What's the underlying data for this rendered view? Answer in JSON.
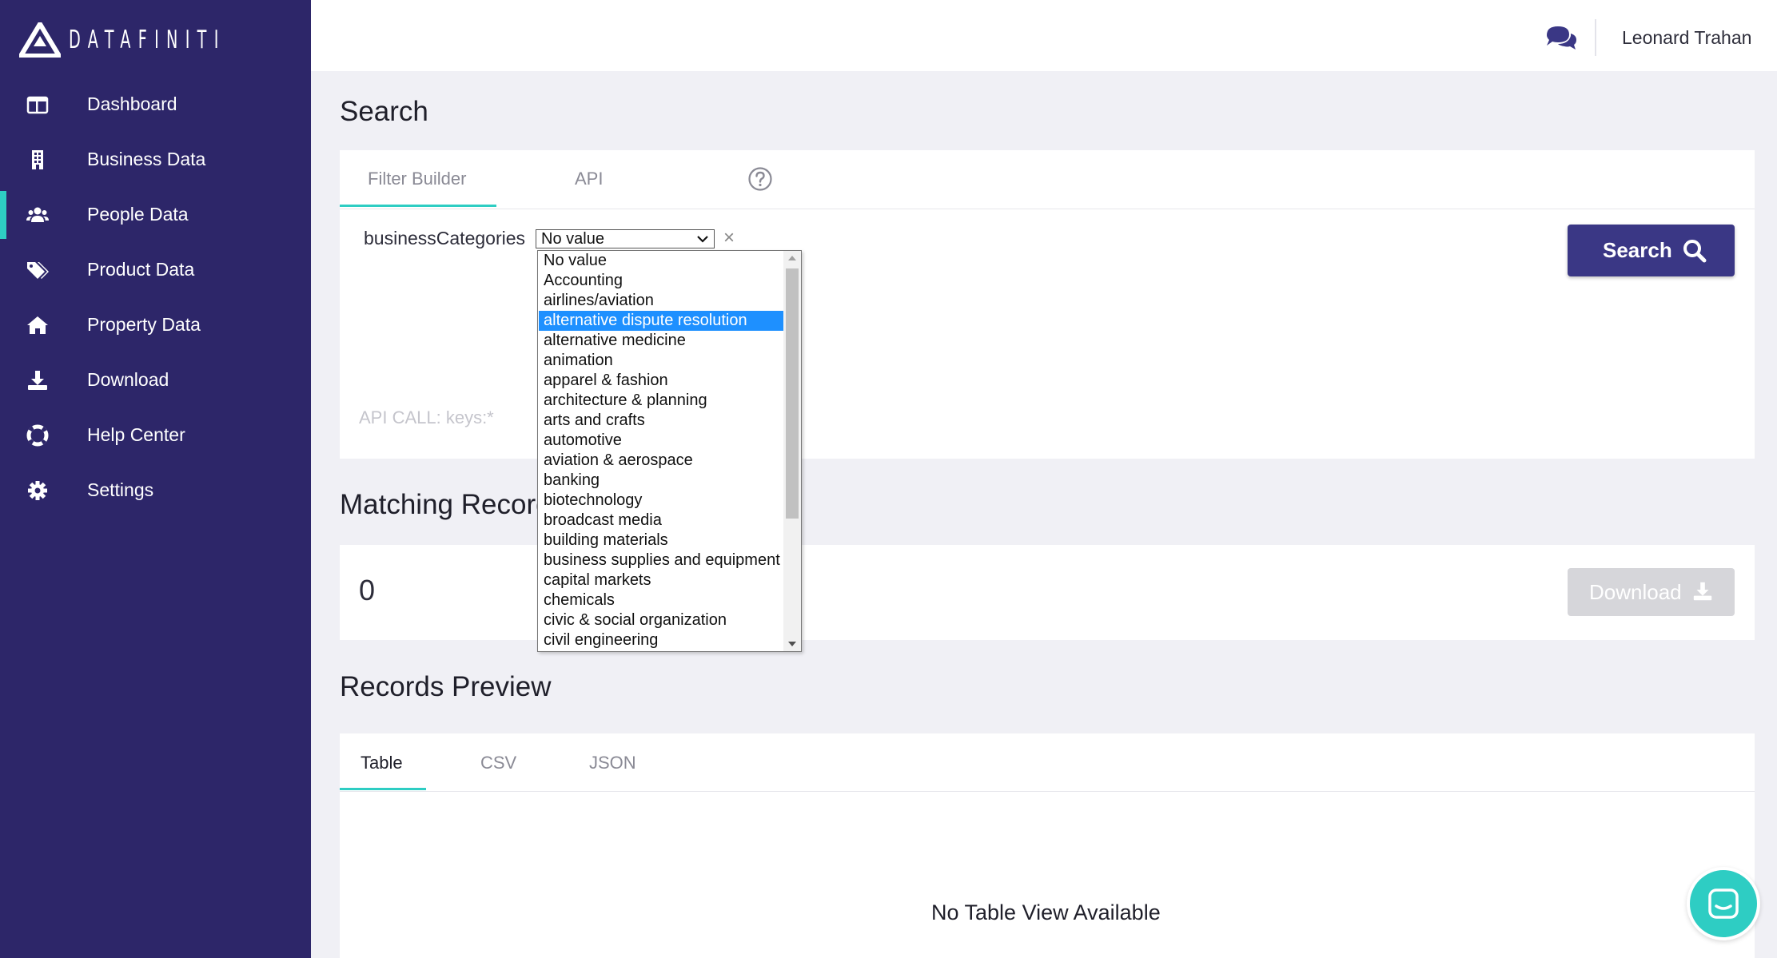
{
  "brand": {
    "name": "DATAFINITI"
  },
  "sidebar": {
    "items": [
      {
        "label": "Dashboard",
        "icon": "dashboard-icon"
      },
      {
        "label": "Business Data",
        "icon": "building-icon"
      },
      {
        "label": "People Data",
        "icon": "users-icon",
        "active": true
      },
      {
        "label": "Product Data",
        "icon": "tags-icon"
      },
      {
        "label": "Property Data",
        "icon": "home-icon"
      },
      {
        "label": "Download",
        "icon": "download-icon"
      },
      {
        "label": "Help Center",
        "icon": "life-ring-icon"
      },
      {
        "label": "Settings",
        "icon": "gear-icon"
      }
    ]
  },
  "header": {
    "user_name": "Leonard Trahan",
    "chat_icon": "comments-icon"
  },
  "search": {
    "title": "Search",
    "tabs": [
      {
        "label": "Filter Builder",
        "active": true
      },
      {
        "label": "API"
      }
    ],
    "help_icon": "question-circle-icon",
    "filter": {
      "field": "businessCategories",
      "selected": "No value",
      "options": [
        "No value",
        "Accounting",
        "airlines/aviation",
        "alternative dispute resolution",
        "alternative medicine",
        "animation",
        "apparel & fashion",
        "architecture & planning",
        "arts and crafts",
        "automotive",
        "aviation & aerospace",
        "banking",
        "biotechnology",
        "broadcast media",
        "building materials",
        "business supplies and equipment",
        "capital markets",
        "chemicals",
        "civic & social organization",
        "civil engineering"
      ],
      "highlighted": "alternative dispute resolution",
      "clear_label": "×"
    },
    "api_call": "API CALL: keys:*",
    "button_label": "Search"
  },
  "matching": {
    "title": "Matching Records",
    "count": "0",
    "download_label": "Download"
  },
  "preview": {
    "title": "Records Preview",
    "tabs": [
      {
        "label": "Table",
        "active": true
      },
      {
        "label": "CSV"
      },
      {
        "label": "JSON"
      }
    ],
    "empty_message": "No Table View Available"
  },
  "colors": {
    "sidebar": "#2d2669",
    "accent": "#2ecdc3",
    "primary_button": "#3a3785",
    "disabled_button": "#d6d6da",
    "selection": "#1e90ff"
  }
}
